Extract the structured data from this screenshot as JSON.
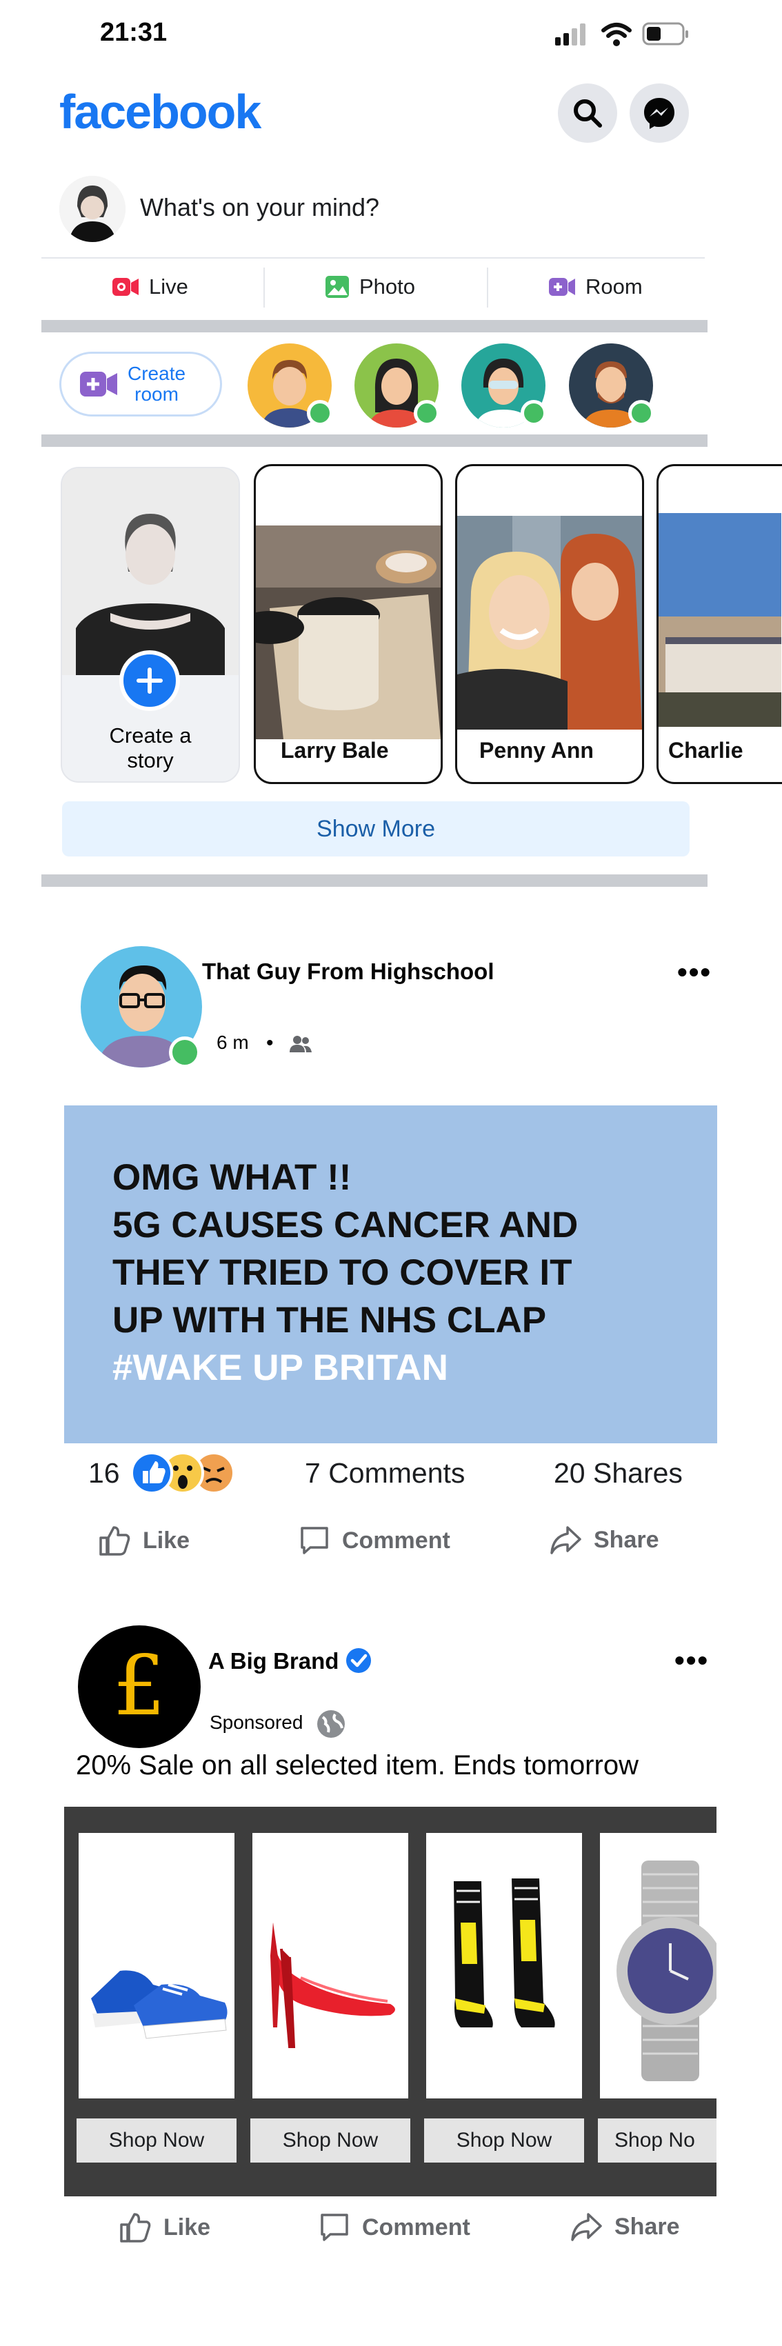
{
  "status_bar": {
    "time": "21:31"
  },
  "header": {
    "logo": "facebook",
    "icons": [
      "search-icon",
      "messenger-icon"
    ]
  },
  "composer": {
    "prompt": "What's on your mind?"
  },
  "actions": [
    {
      "label": "Live",
      "icon": "live-video-icon",
      "color": "#f02849"
    },
    {
      "label": "Photo",
      "icon": "photo-icon",
      "color": "#45bd62"
    },
    {
      "label": "Room",
      "icon": "room-icon",
      "color": "#8c62cc"
    }
  ],
  "rooms": {
    "create_label_line1": "Create",
    "create_label_line2": "room"
  },
  "stories": {
    "create_line1": "Create a",
    "create_line2": "story",
    "items": [
      {
        "name": "Larry Bale"
      },
      {
        "name": "Penny Ann"
      },
      {
        "name": "Charlie"
      }
    ],
    "show_more": "Show More"
  },
  "post": {
    "author": "That Guy From Highschool",
    "time": "6 m",
    "separator": "•",
    "audience_icon": "friends-icon",
    "text_lines": [
      "OMG WHAT !!",
      "5G CAUSES CANCER AND",
      "THEY TRIED TO COVER IT",
      "UP WITH THE NHS CLAP"
    ],
    "hashtag": "#WAKE UP BRITAN",
    "background": "#a2c2e7",
    "reaction_count": "16",
    "comments": "7 Comments",
    "shares": "20 Shares",
    "actions": {
      "like": "Like",
      "comment": "Comment",
      "share": "Share"
    }
  },
  "ad": {
    "brand": "A Big Brand",
    "logo_symbol": "£",
    "sponsored": "Sponsored",
    "caption": "20% Sale on all selected item. Ends tomorrow",
    "products": [
      {
        "icon": "sneakers-icon",
        "button": "Shop Now"
      },
      {
        "icon": "high-heel-icon",
        "button": "Shop Now"
      },
      {
        "icon": "boots-icon",
        "button": "Shop Now"
      },
      {
        "icon": "watch-icon",
        "button": "Shop No"
      }
    ],
    "actions": {
      "like": "Like",
      "comment": "Comment",
      "share": "Share"
    }
  },
  "colors": {
    "brand": "#1877f2",
    "online": "#45bd62",
    "divider": "#c9ccd1"
  }
}
